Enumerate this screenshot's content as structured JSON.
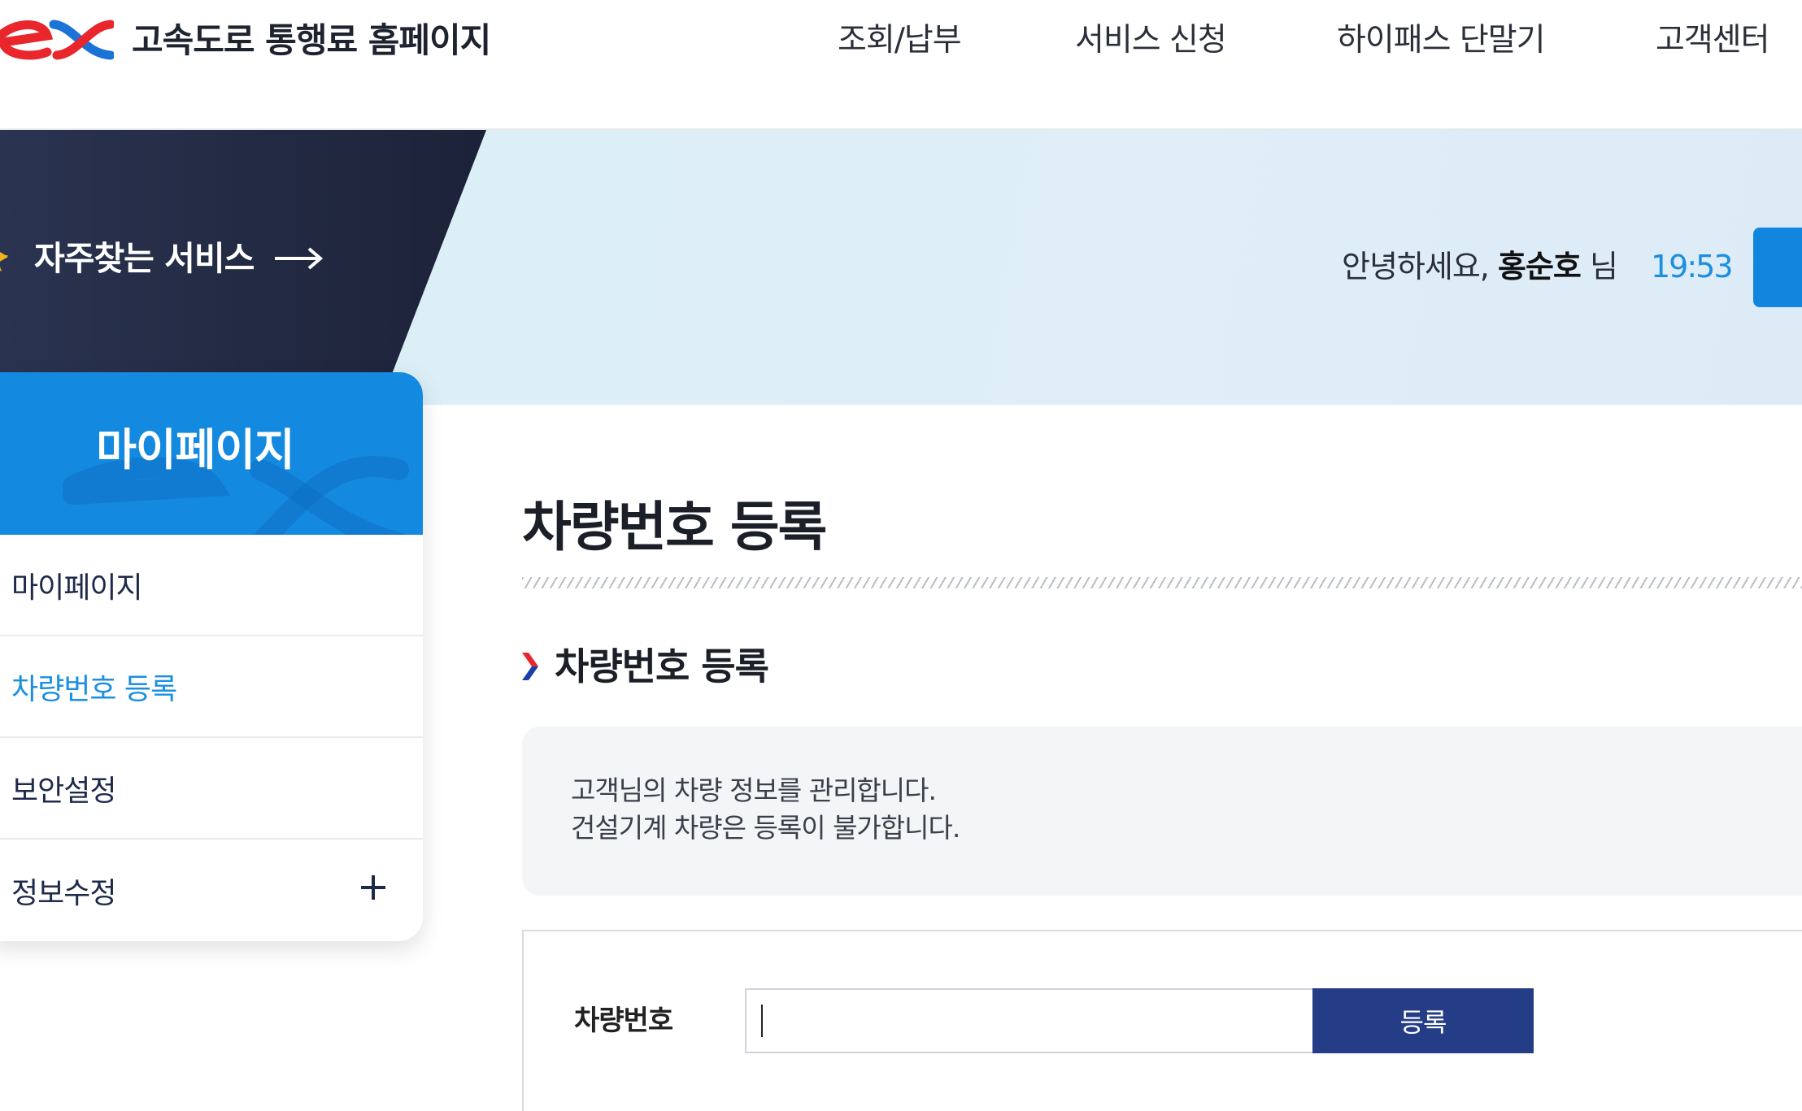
{
  "header": {
    "site_title": "고속도로 통행료 홈페이지",
    "nav": [
      {
        "label": "조회/납부"
      },
      {
        "label": "서비스 신청"
      },
      {
        "label": "하이패스 단말기"
      },
      {
        "label": "고객센터"
      }
    ]
  },
  "banner": {
    "favorite_services_label": "자주찾는 서비스",
    "greeting_prefix": "안녕하세요,",
    "user_name": "홍순호",
    "greeting_suffix": "님",
    "session_time": "19:53"
  },
  "sidebar": {
    "title": "마이페이지",
    "items": [
      {
        "label": "마이페이지",
        "active": false
      },
      {
        "label": "차량번호 등록",
        "active": true
      },
      {
        "label": "보안설정",
        "active": false
      },
      {
        "label": "정보수정",
        "active": false
      }
    ]
  },
  "main": {
    "page_title": "차량번호 등록",
    "section_title": "차량번호 등록",
    "notice_lines": [
      "고객님의 차량 정보를 관리합니다.",
      "건설기계 차량은 등록이 불가합니다."
    ],
    "form": {
      "field_label": "차량번호",
      "field_value": "",
      "submit_label": "등록"
    }
  },
  "colors": {
    "accent_blue": "#1489e0",
    "navy_button": "#253c87",
    "brand_red": "#e8262b",
    "banner_bg": "#dcedf6",
    "dark_panel": "#1e2640"
  }
}
